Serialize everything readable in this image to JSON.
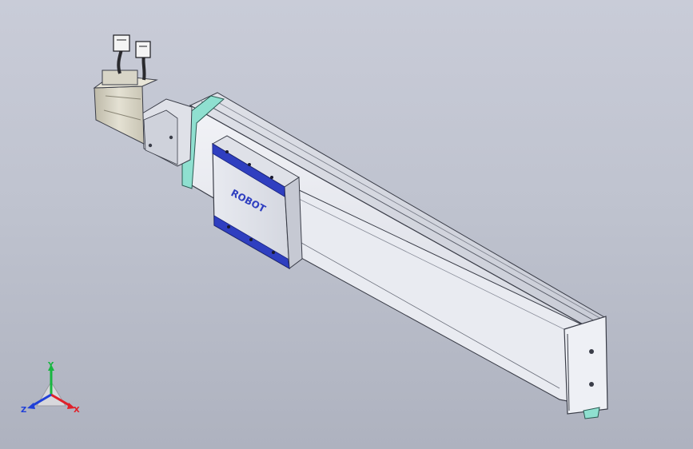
{
  "model": {
    "name": "linear-actuator-with-servo-motor",
    "carriage_logo_text": "ROBOT",
    "colors": {
      "background_top": "#c9ccd8",
      "background_bottom": "#aeb2bf",
      "body": "#e3e5ec",
      "body_shade": "#c6c9d3",
      "edge": "#3a3d48",
      "accent_teal": "#8fe0d0",
      "carriage_blue": "#2f3fc0",
      "motor": "#d6d3c5"
    }
  },
  "triad": {
    "x_label": "X",
    "y_label": "Y",
    "z_label": "Z",
    "x_color": "#e0202a",
    "y_color": "#18b640",
    "z_color": "#2040d8"
  }
}
